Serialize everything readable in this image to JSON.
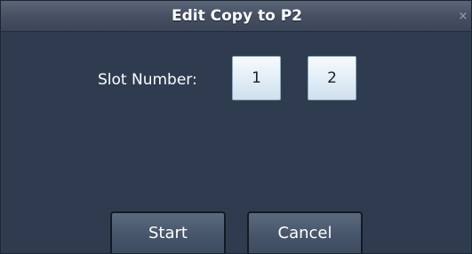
{
  "dialog": {
    "title": "Edit Copy to P2",
    "close_icon": "close-icon",
    "close_glyph": "×"
  },
  "slot": {
    "label": "Slot Number:",
    "options": [
      "1",
      "2"
    ]
  },
  "actions": {
    "start_label": "Start",
    "cancel_label": "Cancel"
  },
  "colors": {
    "dialog_background": "#2f3c4f",
    "titlebar": "#4a5567",
    "slot_button": "#e2eef7"
  }
}
